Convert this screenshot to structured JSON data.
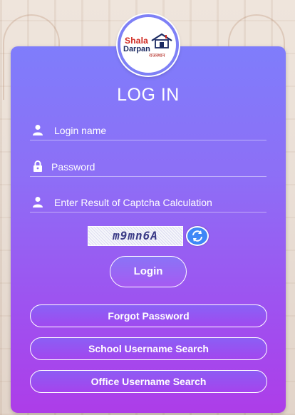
{
  "logo": {
    "line1_a": "Shala",
    "line2": "Darpan",
    "line3": "राजस्थान",
    "icon": "house-icon"
  },
  "form": {
    "title": "LOG IN",
    "login_name_placeholder": "Login name",
    "password_placeholder": "Password",
    "captcha_placeholder": "Enter Result of Captcha Calculation",
    "captcha_text": "m9mn6A",
    "login_button": "Login"
  },
  "links": {
    "forgot_password": "Forgot Password",
    "school_username_search": "School Username Search",
    "office_username_search": "Office Username Search"
  },
  "colors": {
    "card_top": "#7f7dfb",
    "card_bottom": "#ad3de8",
    "refresh_blue": "#3f87f7"
  }
}
